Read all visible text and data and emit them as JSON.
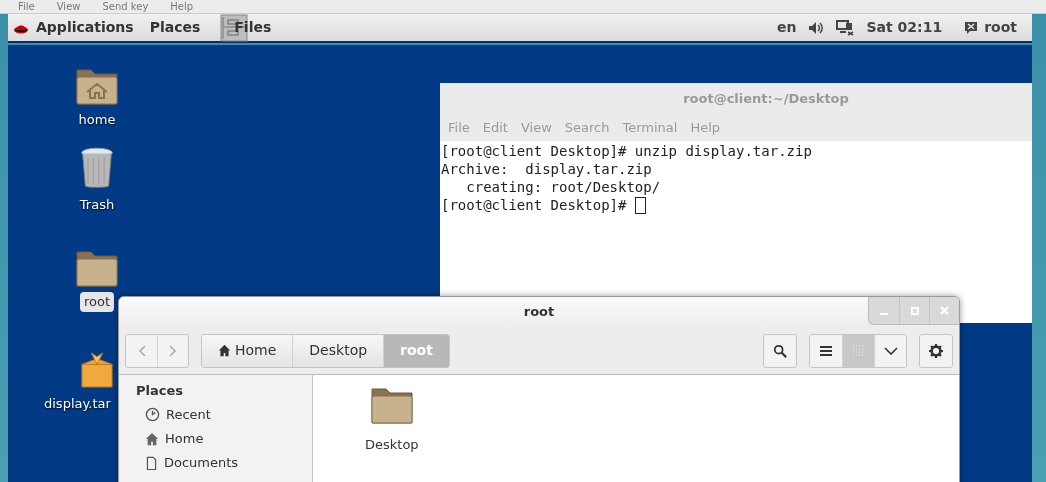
{
  "vm_menu": [
    "File",
    "View",
    "Send key",
    "Help"
  ],
  "top_panel": {
    "applications": "Applications",
    "places": "Places",
    "active_app": "Files",
    "language": "en",
    "clock": "Sat 02:11",
    "user": "root"
  },
  "desktop_icons": [
    {
      "kind": "home-folder",
      "label": "home",
      "selected": false
    },
    {
      "kind": "trash",
      "label": "Trash",
      "selected": false
    },
    {
      "kind": "folder",
      "label": "root",
      "selected": true
    },
    {
      "kind": "package",
      "label": "display.tar",
      "selected": false
    }
  ],
  "terminal": {
    "title": "root@client:~/Desktop",
    "menu": [
      "File",
      "Edit",
      "View",
      "Search",
      "Terminal",
      "Help"
    ],
    "lines": [
      "[root@client Desktop]# unzip display.tar.zip",
      "Archive:  display.tar.zip",
      "   creating: root/Desktop/",
      "[root@client Desktop]# "
    ]
  },
  "files_window": {
    "title": "root",
    "path": [
      {
        "kind": "home",
        "label": "Home",
        "selected": false
      },
      {
        "kind": "plain",
        "label": "Desktop",
        "selected": false
      },
      {
        "kind": "plain",
        "label": "root",
        "selected": true
      }
    ],
    "view_modes": [
      {
        "kind": "list",
        "selected": false
      },
      {
        "kind": "grid",
        "selected": true
      }
    ],
    "sidebar": {
      "heading": "Places",
      "items": [
        {
          "kind": "recent",
          "label": "Recent"
        },
        {
          "kind": "home",
          "label": "Home"
        },
        {
          "kind": "document",
          "label": "Documents"
        }
      ]
    },
    "items": [
      {
        "kind": "folder",
        "label": "Desktop"
      }
    ]
  }
}
